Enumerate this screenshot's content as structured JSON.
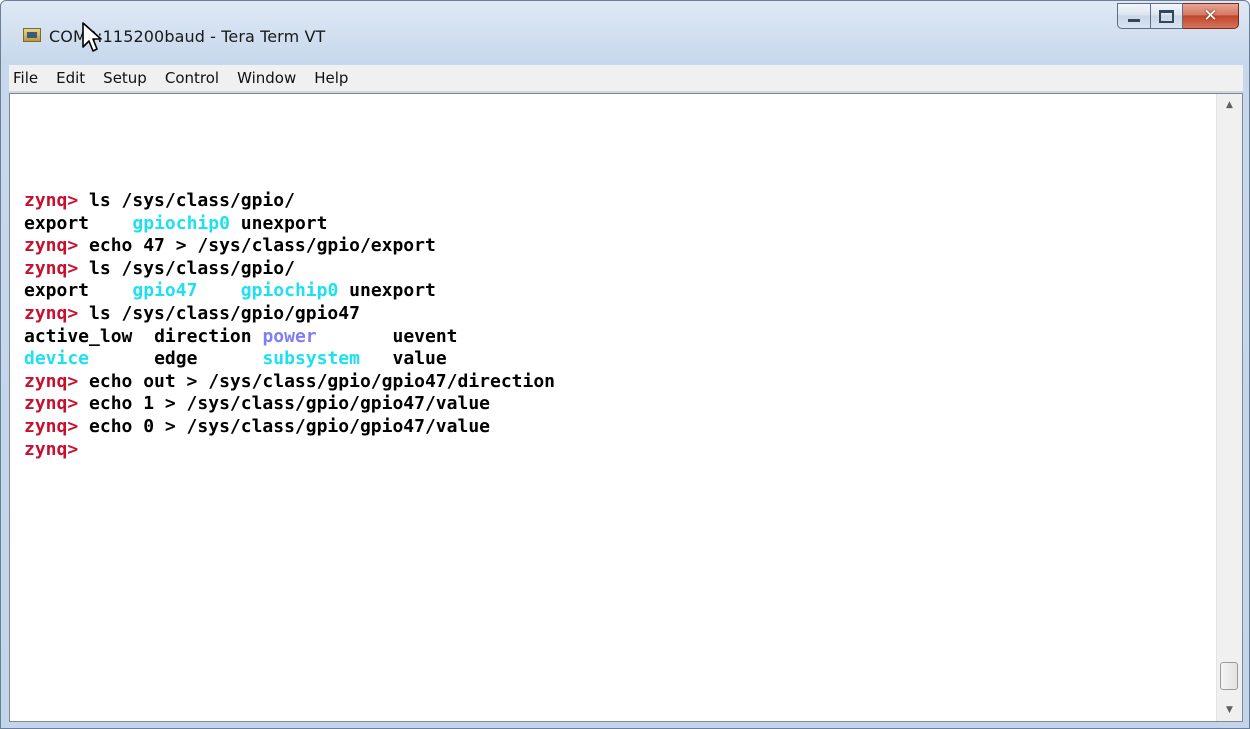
{
  "window": {
    "title": "COM9:115200baud - Tera Term VT"
  },
  "menu": {
    "items": [
      "File",
      "Edit",
      "Setup",
      "Control",
      "Window",
      "Help"
    ]
  },
  "terminal": {
    "prompt": "zynq>",
    "lines": [
      {
        "kind": "cmd",
        "text": " ls /sys/class/gpio/"
      },
      {
        "kind": "out",
        "cols": [
          {
            "text": "export",
            "color": "default"
          },
          {
            "text": "gpiochip0",
            "color": "cyan"
          },
          {
            "text": "unexport",
            "color": "default"
          }
        ]
      },
      {
        "kind": "cmd",
        "text": " echo 47 > /sys/class/gpio/export"
      },
      {
        "kind": "cmd",
        "text": " ls /sys/class/gpio/"
      },
      {
        "kind": "out",
        "cols": [
          {
            "text": "export",
            "color": "default"
          },
          {
            "text": "gpio47",
            "color": "cyan"
          },
          {
            "text": "gpiochip0",
            "color": "cyan"
          },
          {
            "text": "unexport",
            "color": "default"
          }
        ]
      },
      {
        "kind": "cmd",
        "text": " ls /sys/class/gpio/gpio47"
      },
      {
        "kind": "out",
        "cols": [
          {
            "text": "active_low",
            "color": "default"
          },
          {
            "text": "direction",
            "color": "default"
          },
          {
            "text": "power",
            "color": "blue"
          },
          {
            "text": "uevent",
            "color": "default"
          }
        ]
      },
      {
        "kind": "out",
        "cols": [
          {
            "text": "device",
            "color": "cyan"
          },
          {
            "text": "edge",
            "color": "default"
          },
          {
            "text": "subsystem",
            "color": "cyan"
          },
          {
            "text": "value",
            "color": "default"
          }
        ]
      },
      {
        "kind": "cmd",
        "text": " echo out > /sys/class/gpio/gpio47/direction"
      },
      {
        "kind": "cmd",
        "text": " echo 1 > /sys/class/gpio/gpio47/value"
      },
      {
        "kind": "cmd",
        "text": " echo 0 > /sys/class/gpio/gpio47/value"
      },
      {
        "kind": "cmd",
        "text": ""
      }
    ]
  },
  "colors": {
    "prompt": "#c8102e",
    "cyan": "#1ee0f0",
    "blue": "#7f7ff5",
    "default": "#000000"
  },
  "icons": {
    "app": "tera-term-icon",
    "cursor": "mouse-pointer-icon",
    "minimize": "minimize-icon",
    "maximize": "maximize-icon",
    "close": "close-icon",
    "scroll_up": "scroll-up-arrow-icon",
    "scroll_down": "scroll-down-arrow-icon"
  }
}
